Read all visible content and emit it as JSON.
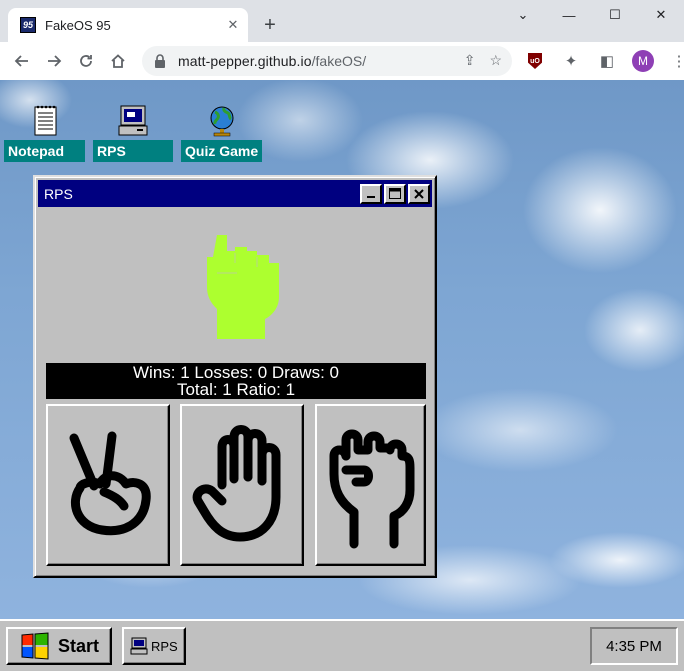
{
  "browser": {
    "tab_title": "FakeOS 95",
    "favicon_text": "95",
    "url_host": "matt-pepper.github.io",
    "url_path": "/fakeOS/",
    "profile_initial": "M",
    "icons": [
      "back-icon",
      "forward-icon",
      "reload-icon",
      "home-icon",
      "lock-icon",
      "share-icon",
      "star-icon",
      "ublock-icon",
      "extensions-icon",
      "sidepanel-icon",
      "menu-icon"
    ]
  },
  "desktop": {
    "icons": [
      {
        "label": "Notepad",
        "icon": "notepad-icon"
      },
      {
        "label": "RPS",
        "icon": "computer-icon"
      },
      {
        "label": "Quiz Game",
        "icon": "globe-icon"
      }
    ]
  },
  "window": {
    "title": "RPS",
    "score_line1": "Wins: 1 Losses: 0 Draws: 0",
    "score_line2": "Total: 1 Ratio: 1",
    "computer_choice": "rock",
    "computer_color": "#adff2f",
    "choices": [
      "scissors",
      "paper",
      "rock"
    ]
  },
  "taskbar": {
    "start_label": "Start",
    "task_label": "RPS",
    "clock": "4:35 PM"
  }
}
